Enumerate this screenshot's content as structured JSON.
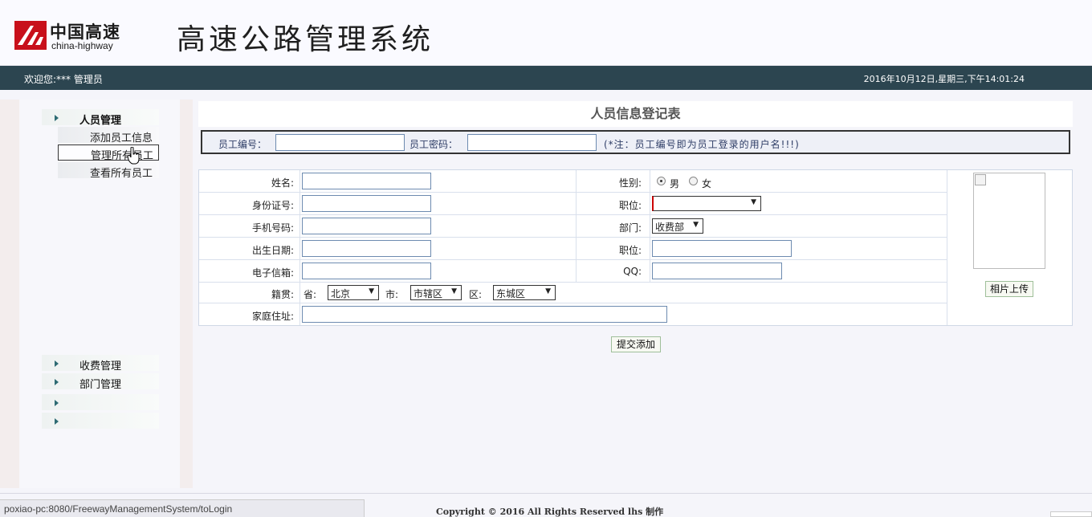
{
  "header": {
    "logo_cn": "中国高速",
    "logo_en": "china-highway",
    "system_title": "高速公路管理系统"
  },
  "topbar": {
    "welcome": "欢迎您:*** 管理员",
    "datetime": "2016年10月12日,星期三,下午14:01:24"
  },
  "sidebar": {
    "groups": [
      {
        "label": "人员管理",
        "items": [
          "添加员工信息",
          "管理所有员工",
          "查看所有员工"
        ]
      },
      {
        "label": "收费管理"
      },
      {
        "label": "部门管理"
      },
      {
        "label": ""
      },
      {
        "label": ""
      }
    ],
    "active_item": "管理所有员工"
  },
  "form": {
    "title": "人员信息登记表",
    "employee_id_label": "员工编号：",
    "employee_pwd_label": "员工密码：",
    "note": "(*注：员工编号即为员工登录的用户名!!!)",
    "fields": {
      "name": "姓名:",
      "id_card": "身份证号:",
      "phone": "手机号码:",
      "birthday": "出生日期:",
      "email": "电子信箱:",
      "native_place": "籍贯:",
      "address": "家庭住址:",
      "gender": "性别:",
      "position": "职位:",
      "department": "部门:",
      "position2": "职位:",
      "qq": "QQ:"
    },
    "gender_options": [
      "男",
      "女"
    ],
    "gender_selected": "男",
    "department_value": "收费部",
    "province_label": "省:",
    "province_value": "北京",
    "city_label": "市:",
    "city_value": "市辖区",
    "district_label": "区:",
    "district_value": "东城区",
    "photo_button": "相片上传",
    "submit_button": "提交添加"
  },
  "status_bar": {
    "url": "poxiao-pc:8080/FreewayManagementSystem/toLogin"
  },
  "footer": {
    "copyright": "Copyright © 2016 All Rights Reserved lhs 制作"
  },
  "colors": {
    "topbar": "#2c4550",
    "logo_red": "#c8101b"
  }
}
